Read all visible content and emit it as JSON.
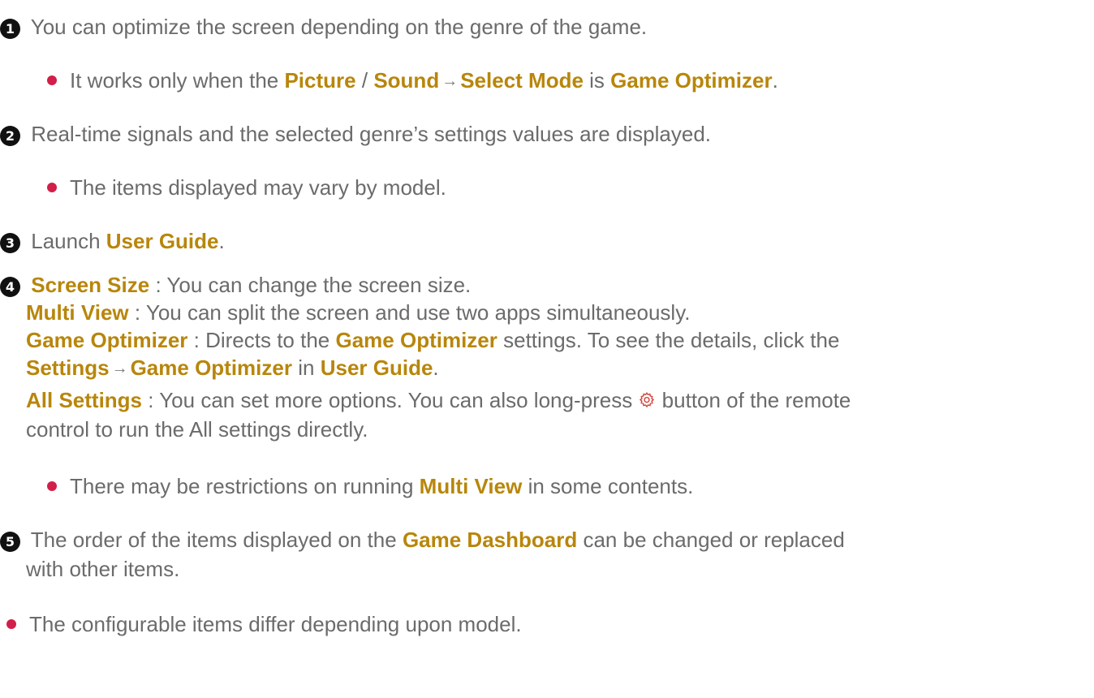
{
  "items": {
    "i1": {
      "num": "1",
      "text": "You can optimize the screen depending on the genre of the game.",
      "sub": {
        "pre": "It works only when the",
        "picture": "Picture",
        "slash": "/",
        "sound": "Sound",
        "select_mode": "Select Mode",
        "is": "is",
        "game_optimizer": "Game Optimizer",
        "end": "."
      }
    },
    "i2": {
      "num": "2",
      "text": "Real-time signals and the selected genre’s settings values are displayed.",
      "sub": "The items displayed may vary by model."
    },
    "i3": {
      "num": "3",
      "pre": "Launch",
      "user_guide": "User Guide",
      "end": "."
    },
    "i4": {
      "num": "4",
      "screen_size": "Screen Size",
      "screen_size_desc": " : You can change the screen size.",
      "multi_view": "Multi View",
      "multi_view_desc": " : You can split the screen and use two apps simultaneously.",
      "game_optimizer": "Game Optimizer",
      "game_optimizer_desc1": " : Directs to the",
      "game_optimizer_ref": "Game Optimizer",
      "game_optimizer_desc2": " settings. To see the details, click the",
      "settings": "Settings",
      "game_optimizer_ref2": "Game Optimizer",
      "in": "in",
      "user_guide": "User Guide",
      "end": ".",
      "all_settings": "All Settings",
      "all_settings_desc1": " : You can set more options. You can also long-press",
      "all_settings_desc2": "button of the remote",
      "all_settings_desc3": "control to run the All settings directly.",
      "sub_pre": "There may be restrictions on running",
      "sub_multi_view": "Multi View",
      "sub_post": "in some contents."
    },
    "i5": {
      "num": "5",
      "pre": "The order of the items displayed on the",
      "game_dashboard": "Game Dashboard",
      "post": "can be changed or replaced",
      "line2": "with other items."
    },
    "footer": "The configurable items differ depending upon model."
  },
  "icons": {
    "arrow": "→",
    "gear": "gear-icon"
  },
  "colors": {
    "highlight": "#b8860b",
    "bullet": "#d21e4a",
    "text": "#6b6b6b",
    "gear": "#d2453e"
  }
}
